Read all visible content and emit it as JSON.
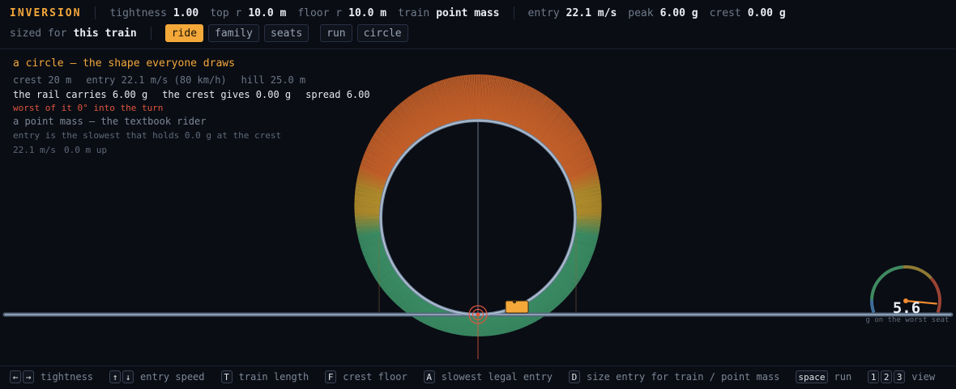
{
  "header": {
    "brand": "INVERSION",
    "stats": [
      {
        "label": "tightness",
        "value": "1.00"
      },
      {
        "label": "top r",
        "value": "10.0 m"
      },
      {
        "label": "floor r",
        "value": "10.0 m"
      },
      {
        "label": "train",
        "value": "point mass"
      }
    ],
    "metrics": [
      {
        "label": "entry",
        "value": "22.1 m/s"
      },
      {
        "label": "peak",
        "value": "6.00 g"
      },
      {
        "label": "crest",
        "value": "0.00 g"
      }
    ],
    "sized_label": "sized for",
    "sized_value": "this train",
    "view_tabs": [
      "ride",
      "family",
      "seats"
    ],
    "active_tab": "ride",
    "shape_tabs": [
      "run",
      "circle"
    ]
  },
  "info": {
    "title": "a circle — the shape everyone draws",
    "crest": "crest 20 m",
    "entry": "entry 22.1 m/s (80 km/h)",
    "hill": "hill 25.0 m",
    "rail": "the rail carries 6.00 g",
    "crest_g": "the crest gives 0.00 g",
    "spread": "spread 6.00",
    "worst": "worst of it 0° into the turn",
    "rider": "a point mass — the textbook rider",
    "entry_note": "entry is the slowest that holds 0.0 g at the crest",
    "speed": "22.1 m/s",
    "up": "0.0 m up"
  },
  "gauge": {
    "value": 5.6,
    "value_text": "5.6",
    "caption": "g on the worst seat",
    "max": 6.0
  },
  "footer": {
    "keys": [
      {
        "keys": [
          "←",
          "→"
        ],
        "label": "tightness"
      },
      {
        "keys": [
          "↑",
          "↓"
        ],
        "label": "entry speed"
      },
      {
        "keys": [
          "T"
        ],
        "label": "train length"
      },
      {
        "keys": [
          "F"
        ],
        "label": "crest floor"
      },
      {
        "keys": [
          "A"
        ],
        "label": "slowest legal entry"
      },
      {
        "keys": [
          "D"
        ],
        "label": "size entry for train / point mass"
      },
      {
        "keys": [
          "space"
        ],
        "label": "run"
      },
      {
        "keys": [
          "1",
          "2",
          "3"
        ],
        "label": "view"
      }
    ]
  },
  "colors": {
    "accent": "#f4a83a",
    "warning": "#e0553e",
    "low_g": "#3f9a6c",
    "mid_g": "#c29a2e",
    "high_g": "#d96a2b",
    "rail": "#7f93ab",
    "background": "#0a0d14"
  }
}
